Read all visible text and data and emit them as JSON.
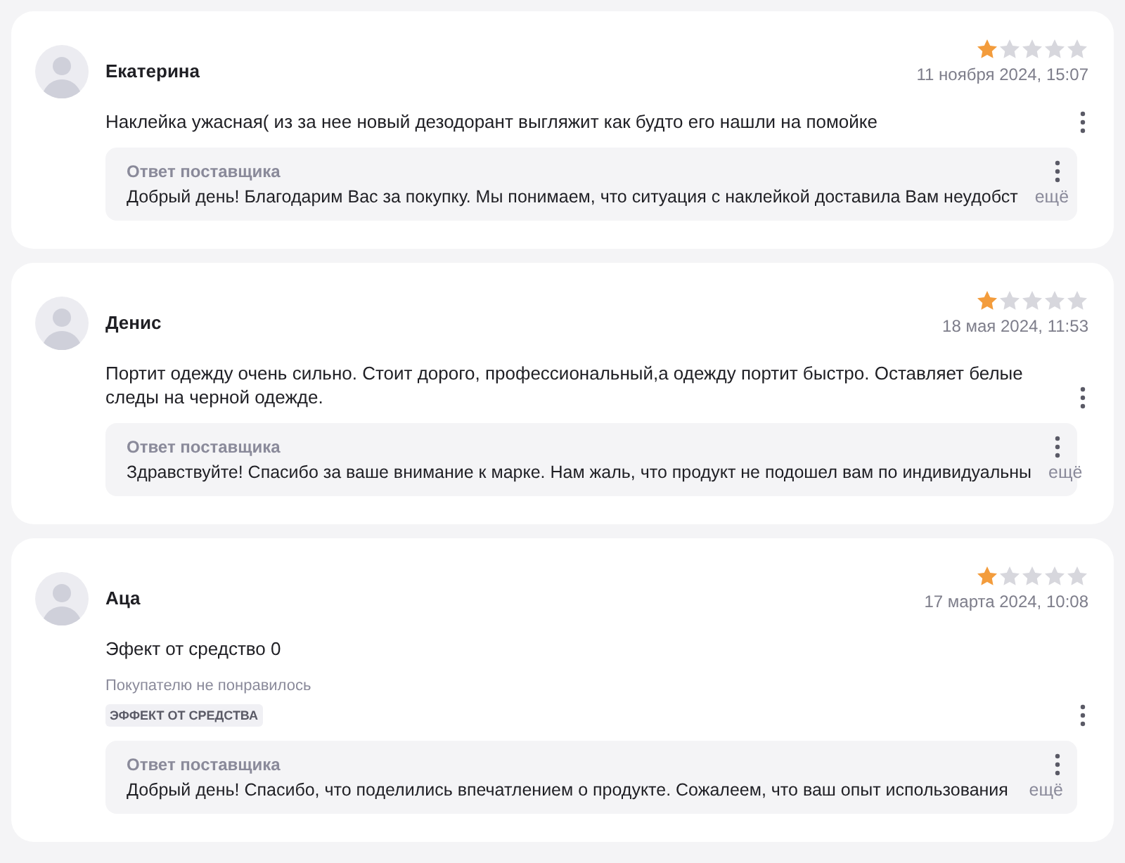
{
  "reviews": [
    {
      "author": "Екатерина",
      "stars": 1,
      "date": "11 ноября 2024, 15:07",
      "text": "Наклейка ужасная( из за нее новый дезодорант выгляжит как будто его нашли на помойке",
      "reply": {
        "title": "Ответ поставщика",
        "text": "Добрый день! Благодарим Вас за покупку. Мы понимаем, что ситуация с наклейкой доставила Вам неудобст",
        "more": "ещё"
      }
    },
    {
      "author": "Денис",
      "stars": 1,
      "date": "18 мая 2024, 11:53",
      "text": "Портит одежду очень сильно. Стоит дорого, профессиональный,а одежду портит быстро. Оставляет белые следы на черной одежде.",
      "reply": {
        "title": "Ответ поставщика",
        "text": "Здравствуйте! Спасибо за ваше внимание к марке. Нам жаль, что продукт не подошел вам по индивидуальны",
        "more": "ещё"
      }
    },
    {
      "author": "Аца",
      "stars": 1,
      "date": "17 марта 2024, 10:08",
      "text": "Эфект от средство 0",
      "dislike": {
        "label": "Покупателю не понравилось",
        "tags": [
          "ЭФФЕКТ ОТ СРЕДСТВА"
        ]
      },
      "reply": {
        "title": "Ответ поставщика",
        "text": "Добрый день! Спасибо, что поделились впечатлением о продукте. Сожалеем, что ваш опыт использования",
        "more": "ещё"
      }
    }
  ]
}
